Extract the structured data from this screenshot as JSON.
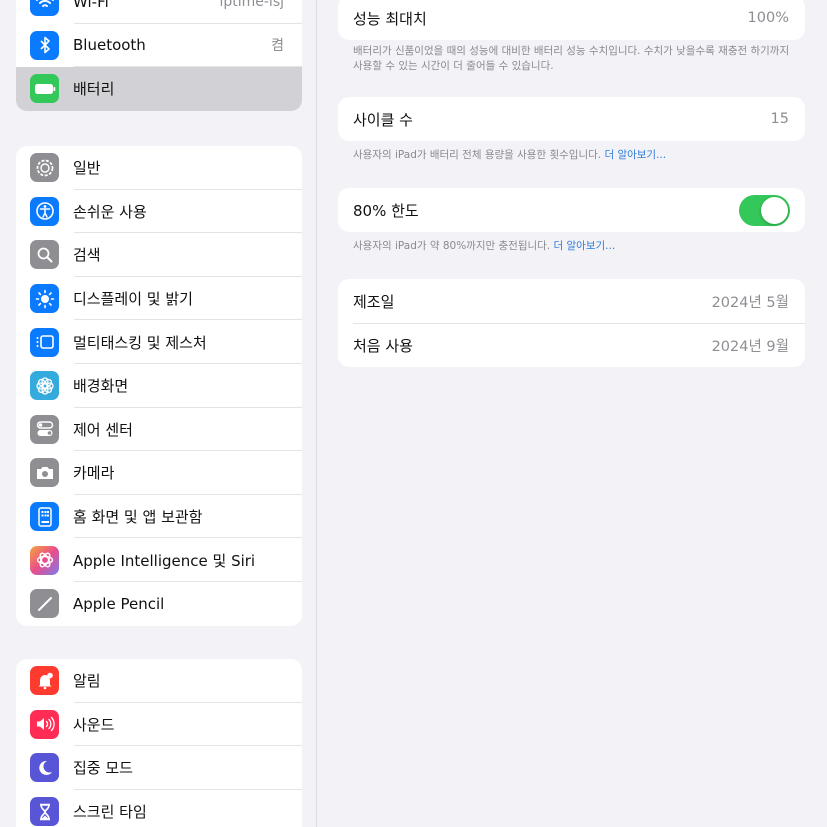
{
  "sidebar": {
    "group1": [
      {
        "label": "Wi-Fi",
        "value": "iptime-isj",
        "icon": "wifi-icon",
        "color": "#0a7aff"
      },
      {
        "label": "Bluetooth",
        "value": "켬",
        "icon": "bluetooth-icon",
        "color": "#0a7aff"
      },
      {
        "label": "배터리",
        "value": "",
        "icon": "battery-icon",
        "color": "#34c759",
        "selected": true
      }
    ],
    "group2": [
      {
        "label": "일반",
        "icon": "gear-icon",
        "color": "#8e8e93"
      },
      {
        "label": "손쉬운 사용",
        "icon": "accessibility-icon",
        "color": "#0a7aff"
      },
      {
        "label": "검색",
        "icon": "search-icon",
        "color": "#8e8e93"
      },
      {
        "label": "디스플레이 및 밝기",
        "icon": "brightness-icon",
        "color": "#0a7aff"
      },
      {
        "label": "멀티태스킹 및 제스처",
        "icon": "multitasking-icon",
        "color": "#0a7aff"
      },
      {
        "label": "배경화면",
        "icon": "wallpaper-icon",
        "color": "#35aadc"
      },
      {
        "label": "제어 센터",
        "icon": "control-center-icon",
        "color": "#8e8e93"
      },
      {
        "label": "카메라",
        "icon": "camera-icon",
        "color": "#8e8e93"
      },
      {
        "label": "홈 화면 및 앱 보관함",
        "icon": "home-screen-icon",
        "color": "#0a7aff"
      },
      {
        "label": "Apple Intelligence 및 Siri",
        "icon": "apple-intelligence-icon",
        "color": "#e0609a"
      },
      {
        "label": "Apple Pencil",
        "icon": "pencil-icon",
        "color": "#8e8e93"
      }
    ],
    "group3": [
      {
        "label": "알림",
        "icon": "bell-icon",
        "color": "#ff3b30"
      },
      {
        "label": "사운드",
        "icon": "speaker-icon",
        "color": "#ff2d55"
      },
      {
        "label": "집중 모드",
        "icon": "moon-icon",
        "color": "#5856d6"
      },
      {
        "label": "스크린 타임",
        "icon": "hourglass-icon",
        "color": "#5856d6"
      }
    ]
  },
  "main": {
    "max_capacity": {
      "label": "성능 최대치",
      "value": "100%"
    },
    "max_capacity_note": "배터리가 신품이었을 때의 성능에 대비한 배터리 성능 수치입니다. 수치가 낮을수록 재충전 하기까지 사용할 수 있는 시간이 더 줄어들 수 있습니다.",
    "cycle_count": {
      "label": "사이클 수",
      "value": "15"
    },
    "cycle_note": "사용자의 iPad가 배터리 전체 용량을 사용한 횟수입니다.",
    "learn_more": "더 알아보기...",
    "limit": {
      "label": "80% 한도",
      "enabled": true
    },
    "limit_note": "사용자의 iPad가 약 80%까지만 충전됩니다.",
    "manufactured": {
      "label": "제조일",
      "value": "2024년 5월"
    },
    "first_use": {
      "label": "처음 사용",
      "value": "2024년 9월"
    }
  }
}
